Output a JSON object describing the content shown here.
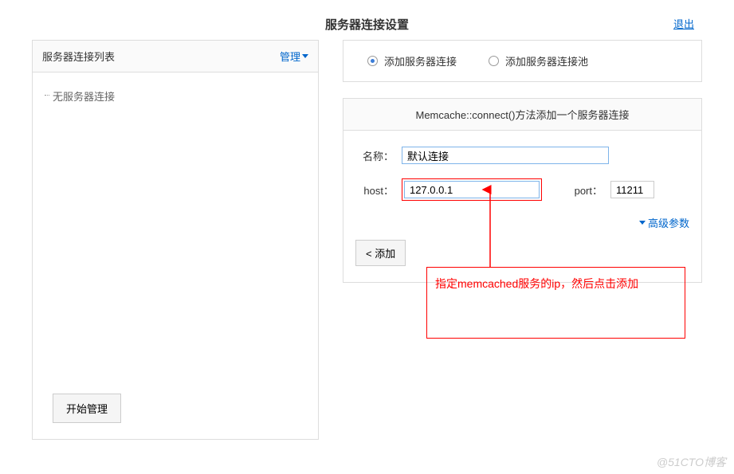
{
  "header": {
    "title": "服务器连接设置",
    "logout": "退出"
  },
  "sidebar": {
    "title": "服务器连接列表",
    "manage_label": "管理",
    "empty_text": "无服务器连接",
    "start_button": "开始管理"
  },
  "radio": {
    "add_server": "添加服务器连接",
    "add_pool": "添加服务器连接池"
  },
  "form": {
    "title": "Memcache::connect()方法添加一个服务器连接",
    "name_label": "名称：",
    "name_value": "默认连接",
    "host_label": "host：",
    "host_value": "127.0.0.1",
    "port_label": "port：",
    "port_value": "11211",
    "advanced": "高级参数",
    "add_button": "< 添加"
  },
  "annotation": {
    "text": "指定memcached服务的ip，然后点击添加"
  },
  "watermark": "@51CTO博客"
}
